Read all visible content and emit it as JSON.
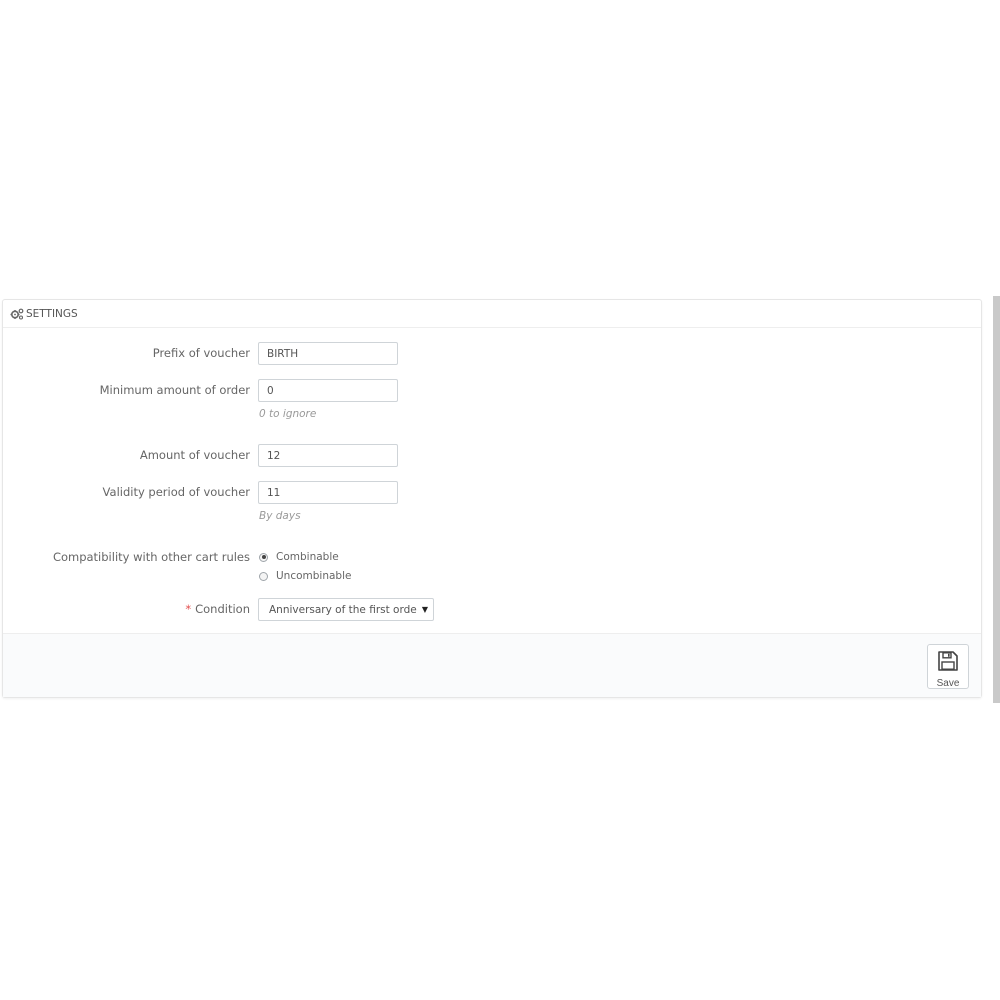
{
  "panel": {
    "title": "SETTINGS",
    "icon": "gears-icon"
  },
  "fields": {
    "prefix": {
      "label": "Prefix of voucher",
      "value": "BIRTH"
    },
    "min_amount": {
      "label": "Minimum amount of order",
      "value": "0",
      "help": "0 to ignore"
    },
    "amount": {
      "label": "Amount of voucher",
      "value": "12"
    },
    "validity": {
      "label": "Validity period of voucher",
      "value": "11",
      "help": "By days"
    },
    "compatibility": {
      "label": "Compatibility with other cart rules",
      "options": [
        {
          "label": "Combinable",
          "checked": true
        },
        {
          "label": "Uncombinable",
          "checked": false
        }
      ]
    },
    "condition": {
      "required_mark": "*",
      "label": "Condition",
      "selected": "Anniversary of the first orde"
    }
  },
  "footer": {
    "save_label": "Save",
    "save_icon": "floppy-disk-icon"
  },
  "colors": {
    "required": "#e24c4c",
    "help": "#999999",
    "footer_bg": "#fafbfc"
  }
}
